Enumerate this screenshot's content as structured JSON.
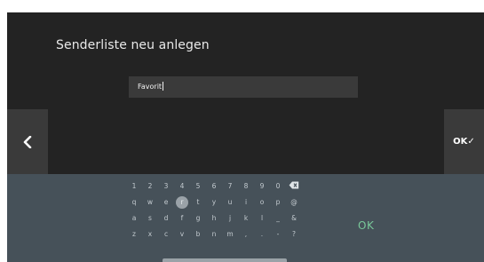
{
  "dialog": {
    "title": "Senderliste neu anlegen",
    "input_value": "Favorit",
    "back_icon": "chevron-left-icon",
    "confirm_label": "OK✓"
  },
  "keyboard": {
    "row1": [
      "1",
      "2",
      "3",
      "4",
      "5",
      "6",
      "7",
      "8",
      "9",
      "0"
    ],
    "backspace_icon": "backspace-icon",
    "row2": [
      "q",
      "w",
      "e",
      "r",
      "t",
      "y",
      "u",
      "i",
      "o",
      "p",
      "@"
    ],
    "row3": [
      "a",
      "s",
      "d",
      "f",
      "g",
      "h",
      "j",
      "k",
      "l",
      "_",
      "&"
    ],
    "row4": [
      "z",
      "x",
      "c",
      "v",
      "b",
      "n",
      "m",
      ",",
      ".",
      "-",
      "?"
    ],
    "highlighted_key": "r",
    "ok_label": "OK",
    "accent_color": "#79c89a"
  }
}
